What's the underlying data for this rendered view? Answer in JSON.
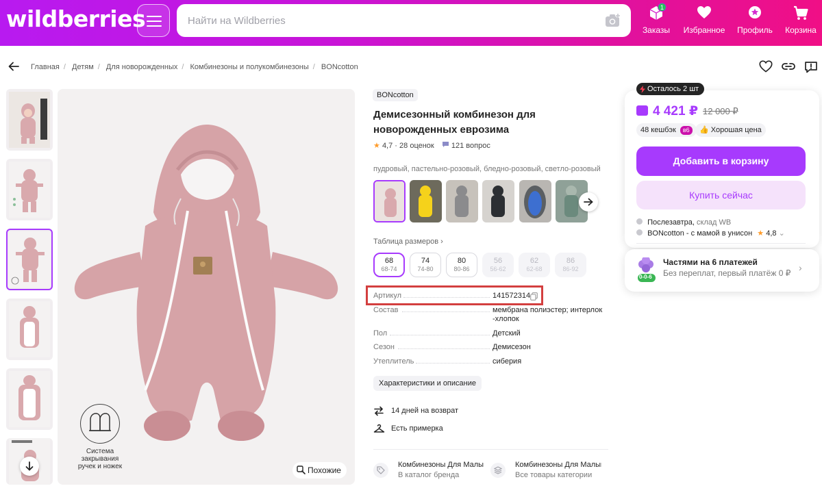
{
  "header": {
    "logo": "wildberries",
    "search_placeholder": "Найти на Wildberries",
    "nav": [
      {
        "label": "Заказы",
        "icon": "box-icon",
        "badge": "1"
      },
      {
        "label": "Избранное",
        "icon": "heart-icon"
      },
      {
        "label": "Профиль",
        "icon": "profile-icon"
      },
      {
        "label": "Корзина",
        "icon": "cart-icon"
      }
    ],
    "colors": {
      "gradient_start": "#b81af0",
      "gradient_end": "#f00f86"
    }
  },
  "breadcrumb": [
    "Главная",
    "Детям",
    "Для новорожденных",
    "Комбинезоны и полукомбинезоны",
    "BONcotton"
  ],
  "gallery": {
    "thumb_count": 6,
    "selected_index": 2,
    "overlay_label": "Система закрывания ручек и ножек",
    "similar_label": "Похожие"
  },
  "product": {
    "brand": "BONcotton",
    "title": "Демисезонный комбинезон для новорожденных еврозима",
    "rating": "4,7",
    "ratings_count": "28 оценок",
    "questions": "121 вопрос",
    "colors_text": "пудровый, пастельно-розовый, бледно-розовый, светло-розовый",
    "color_variant_count": 6,
    "size_table_label": "Таблица размеров",
    "sizes": [
      {
        "size": "68",
        "range": "68-74",
        "state": "selected"
      },
      {
        "size": "74",
        "range": "74-80",
        "state": "available"
      },
      {
        "size": "80",
        "range": "80-86",
        "state": "available"
      },
      {
        "size": "56",
        "range": "56-62",
        "state": "disabled"
      },
      {
        "size": "62",
        "range": "62-68",
        "state": "disabled"
      },
      {
        "size": "86",
        "range": "86-92",
        "state": "disabled"
      }
    ],
    "params": [
      {
        "key": "Артикул",
        "value": "141572314"
      },
      {
        "key": "Состав",
        "value": "мембрана полиэстер; интерлок -хлопок"
      },
      {
        "key": "Пол",
        "value": "Детский"
      },
      {
        "key": "Сезон",
        "value": "Демисезон"
      },
      {
        "key": "Утеплитель",
        "value": "сиберия"
      }
    ],
    "details_button": "Характеристики и описание",
    "features": [
      {
        "icon": "return-icon",
        "text": "14 дней на возврат"
      },
      {
        "icon": "hanger-icon",
        "text": "Есть примерка"
      }
    ],
    "catalog_links": [
      {
        "title": "Комбинезоны Для Малы",
        "subtitle": "В каталог бренда"
      },
      {
        "title": "Комбинезоны Для Малыш",
        "subtitle": "Все товары категории"
      }
    ]
  },
  "buybox": {
    "stock_badge": "Осталось 2 шт",
    "price": "4 421 ₽",
    "old_price": "12 000 ₽",
    "cashback": "48 кешбэк",
    "cashback_tag": "в6",
    "good_price": "Хорошая цена",
    "add_to_cart": "Добавить в корзину",
    "buy_now": "Купить сейчас",
    "delivery_day": "Послезавтра,",
    "delivery_warehouse": "склад WB",
    "seller": "BONcotton - с мамой в унисон",
    "seller_rating": "4,8",
    "installment_title": "Частями на 6 платежей",
    "installment_subtitle": "Без переплат, первый платёж 0 ₽",
    "installment_tag": "0-0-6",
    "colors": {
      "accent": "#a73afd",
      "accent_light": "#f5e2fb",
      "pink": "#cb11ab"
    }
  }
}
